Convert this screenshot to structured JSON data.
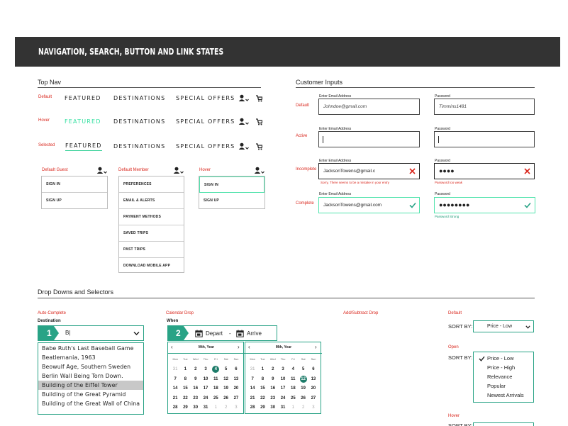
{
  "header": {
    "title": "NAVIGATION, SEARCH, BUTTON AND LINK STATES"
  },
  "top_nav": {
    "title": "Top Nav",
    "states": [
      {
        "label": "Default",
        "items": [
          "FEATURED",
          "DESTINATIONS",
          "SPECIAL OFFERS"
        ]
      },
      {
        "label": "Hover",
        "items": [
          "FEATURED",
          "DESTINATIONS",
          "SPECIAL OFFERS"
        ]
      },
      {
        "label": "Selected",
        "items": [
          "FEATURED",
          "DESTINATIONS",
          "SPECIAL OFFERS"
        ]
      }
    ],
    "icons": [
      "user-icon",
      "chevron-down-icon",
      "cart-icon"
    ],
    "accent_color": "#32e0a0",
    "dropdowns": [
      {
        "label": "Default Guest",
        "items": [
          "SIGN IN",
          "SIGN UP"
        ]
      },
      {
        "label": "Default Member",
        "items": [
          "PREFERENCES",
          "EMAIL & ALERTS",
          "PAYMENT METHODS",
          "SAVED TRIPS",
          "PAST TRIPS",
          "DOWNLOAD MOBILE APP"
        ]
      },
      {
        "label": "Hover",
        "items": [
          "SIGN IN",
          "SIGN UP"
        ]
      }
    ]
  },
  "customer_inputs": {
    "title": "Customer Inputs",
    "email_label": "Enter Email Address",
    "password_label": "Password",
    "rows": [
      {
        "label": "Default",
        "email": "Johndoe@gmail.com",
        "password": "Timmins1481"
      },
      {
        "label": "Active",
        "email": "",
        "password": ""
      },
      {
        "label": "Incomplete",
        "email": "JacksonTowens@gmail.c",
        "password": "●●●●",
        "email_msg": "Sorry, There seems to be a mistake in your entry",
        "password_msg": "Password too weak"
      },
      {
        "label": "Complete",
        "email": "JacksonTowens@gmail.com",
        "password": "●●●●●●●●",
        "password_msg": "Password Strong"
      }
    ],
    "error_color": "#d9261c",
    "success_color": "#29a386"
  },
  "dropdowns_selectors": {
    "title": "Drop Downs and Selectors",
    "autocomplete": {
      "label": "Auto-Complete",
      "field_label": "Destination",
      "step": "1",
      "value": "B|",
      "suggestions": [
        "Babe Ruth's Last Baseball Game",
        "Beatlemania, 1963",
        "Beowulf Age, Southern Sweden",
        "Berlin Wall Being Torn Down.",
        "Building of the Eiffel Tower",
        "Building of the Great Pyramid",
        "Building of the Great Wall of China"
      ],
      "selected_index": 4
    },
    "calendar": {
      "label": "Calendar Drop",
      "field_label": "When",
      "step": "2",
      "depart": "Depart",
      "separator": "-",
      "arrive": "Arrive",
      "months": [
        {
          "title": "Mth, Year",
          "highlight": "4"
        },
        {
          "title": "Mth, Year",
          "highlight": "12"
        }
      ],
      "weekdays": [
        "Mon",
        "Tue",
        "Wed",
        "Thu",
        "Fri",
        "Sat",
        "Sun"
      ],
      "weeks": [
        [
          "31",
          "1",
          "2",
          "3",
          "4",
          "5",
          "6"
        ],
        [
          "7",
          "8",
          "9",
          "10",
          "11",
          "12",
          "13"
        ],
        [
          "14",
          "15",
          "16",
          "17",
          "18",
          "19",
          "20"
        ],
        [
          "21",
          "22",
          "23",
          "24",
          "25",
          "26",
          "27"
        ],
        [
          "28",
          "29",
          "30",
          "31",
          "1",
          "2",
          "3"
        ]
      ],
      "prev_arrow": "‹",
      "next_arrow": "›"
    },
    "add_subtract": {
      "label": "Add/Subtract Drop"
    },
    "sort": {
      "default_label": "Default",
      "open_label": "Open",
      "hover_label": "Hover",
      "sort_by": "SORT BY:",
      "selected": "Price - Low",
      "options": [
        "Price - Low",
        "Price - High",
        "Relevance",
        "Popular",
        "Newest Arrivals"
      ]
    }
  }
}
